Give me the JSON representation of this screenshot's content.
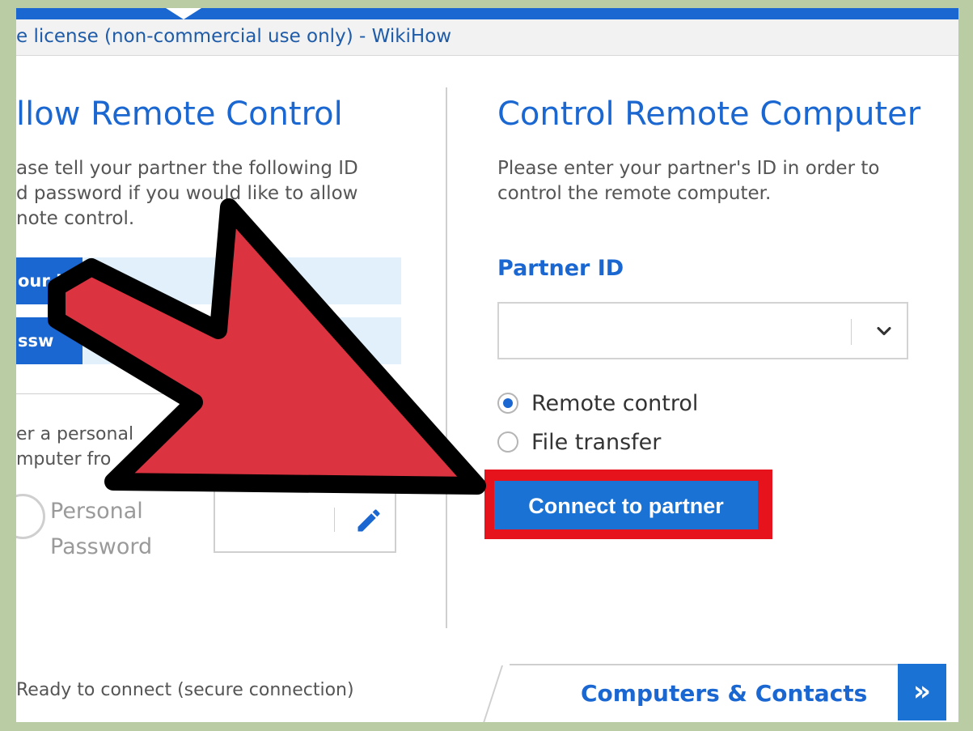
{
  "window": {
    "title": "e license (non-commercial use only) - WikiHow"
  },
  "left_panel": {
    "heading": "llow Remote Control",
    "description": "ase tell your partner the following ID\nd password if you would like to allow\nnote control.",
    "your_id_label": "our I",
    "password_label": "ssw",
    "personal_description": "er a personal\nmputer fro",
    "personal_password_label": "Personal\nPassword"
  },
  "right_panel": {
    "heading": "Control Remote Computer",
    "description": "Please enter your partner's ID in order to\ncontrol the remote computer.",
    "partner_id_label": "Partner ID",
    "partner_id_value": "",
    "options": [
      {
        "label": "Remote control",
        "checked": true
      },
      {
        "label": "File transfer",
        "checked": false
      }
    ],
    "connect_label": "Connect to partner"
  },
  "status": {
    "text": "Ready to connect (secure connection)"
  },
  "bottom": {
    "contacts_label": "Computers & Contacts",
    "expand_label": "»"
  },
  "colors": {
    "accent": "#1a67d2",
    "highlight": "#e6131c",
    "arrow": "#dc3340",
    "frame": "#b9cca3"
  },
  "icons": {
    "dropdown": "chevron-down-icon",
    "edit": "pencil-icon",
    "lock": "lock-icon",
    "expand": "double-chevron-right-icon",
    "pointer": "arrow-icon"
  }
}
